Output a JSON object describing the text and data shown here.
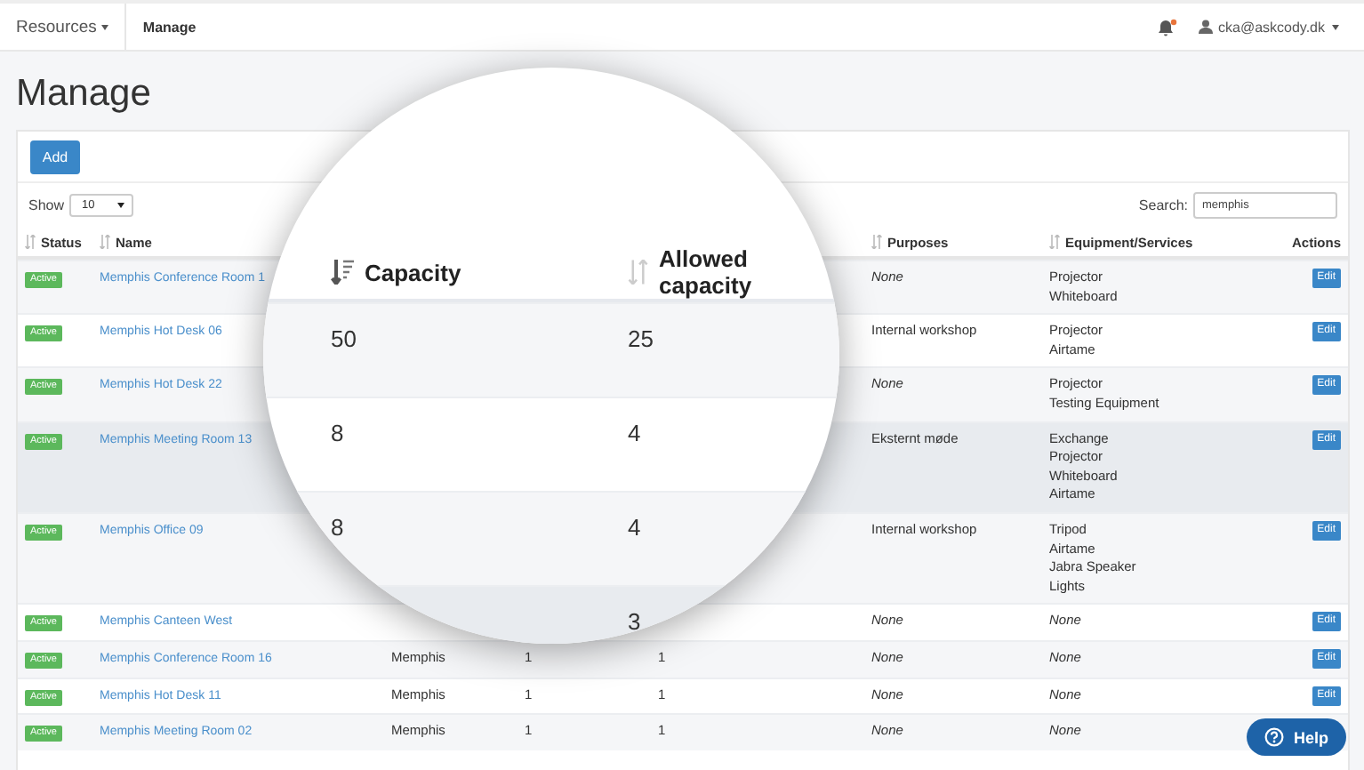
{
  "navbar": {
    "menu": "Resources",
    "current": "Manage",
    "user": "cka@askcody.dk"
  },
  "page_title": "Manage",
  "toolbar": {
    "add_button": "Add",
    "show_label": "Show",
    "page_size": "10",
    "search_label": "Search:",
    "search_value": "memphis"
  },
  "table": {
    "columns": [
      {
        "label": "Status",
        "sortable": true
      },
      {
        "label": "Name",
        "sortable": true
      },
      {
        "label": "Purposes",
        "sortable": true
      },
      {
        "label": "Equipment/Services",
        "sortable": true
      },
      {
        "label": "Actions",
        "sortable": false
      }
    ],
    "rows": [
      {
        "status": "Active",
        "name": "Memphis Conference Room 1",
        "purposes": {
          "text": "None",
          "empty": true
        },
        "equipment": {
          "items": [
            "Projector",
            "Whiteboard"
          ],
          "empty": false
        },
        "action": "Edit",
        "highlighted": false
      },
      {
        "status": "Active",
        "name": "Memphis Hot Desk 06",
        "purposes": {
          "text": "Internal workshop",
          "empty": false
        },
        "equipment": {
          "items": [
            "Projector",
            "Airtame"
          ],
          "empty": false
        },
        "action": "Edit",
        "highlighted": false
      },
      {
        "status": "Active",
        "name": "Memphis Hot Desk 22",
        "purposes": {
          "text": "None",
          "empty": true
        },
        "equipment": {
          "items": [
            "Projector",
            "Testing Equipment"
          ],
          "empty": false
        },
        "action": "Edit",
        "highlighted": false
      },
      {
        "status": "Active",
        "name": "Memphis Meeting Room 13",
        "purposes": {
          "text": "Eksternt møde",
          "empty": false
        },
        "equipment": {
          "items": [
            "Exchange",
            "Projector",
            "Whiteboard",
            "Airtame"
          ],
          "empty": false
        },
        "action": "Edit",
        "highlighted": true
      },
      {
        "status": "Active",
        "name": "Memphis Office 09",
        "purposes": {
          "text": "Internal workshop",
          "empty": false
        },
        "equipment": {
          "items": [
            "Tripod",
            "Airtame",
            "Jabra Speaker",
            "Lights"
          ],
          "empty": false
        },
        "action": "Edit",
        "highlighted": false
      },
      {
        "status": "Active",
        "name": "Memphis Canteen West",
        "purposes": {
          "text": "None",
          "empty": true
        },
        "equipment": {
          "items": [
            "None"
          ],
          "empty": true
        },
        "action": "Edit",
        "highlighted": false
      },
      {
        "status": "Active",
        "name": "Memphis Conference Room 16",
        "location": "Memphis",
        "capacity": "1",
        "allowed": "1",
        "purposes": {
          "text": "None",
          "empty": true
        },
        "equipment": {
          "items": [
            "None"
          ],
          "empty": true
        },
        "action": "Edit",
        "highlighted": false
      },
      {
        "status": "Active",
        "name": "Memphis Hot Desk 11",
        "location": "Memphis",
        "capacity": "1",
        "allowed": "1",
        "purposes": {
          "text": "None",
          "empty": true
        },
        "equipment": {
          "items": [
            "None"
          ],
          "empty": true
        },
        "action": "Edit",
        "highlighted": false
      },
      {
        "status": "Active",
        "name": "Memphis Meeting Room 02",
        "location": "Memphis",
        "capacity": "1",
        "allowed": "1",
        "purposes": {
          "text": "None",
          "empty": true
        },
        "equipment": {
          "items": [
            "None"
          ],
          "empty": true
        },
        "highlighted": false
      }
    ]
  },
  "magnifier": {
    "columns": [
      {
        "label": "Capacity",
        "sorted": true
      },
      {
        "label": "Allowed capacity",
        "sorted": false
      }
    ],
    "rows": [
      {
        "capacity": "50",
        "allowed": "25",
        "highlighted": false
      },
      {
        "capacity": "8",
        "allowed": "4",
        "highlighted": false
      },
      {
        "capacity": "8",
        "allowed": "4",
        "highlighted": false
      },
      {
        "allowed": "3",
        "highlighted": true
      }
    ]
  },
  "help_button": "Help"
}
